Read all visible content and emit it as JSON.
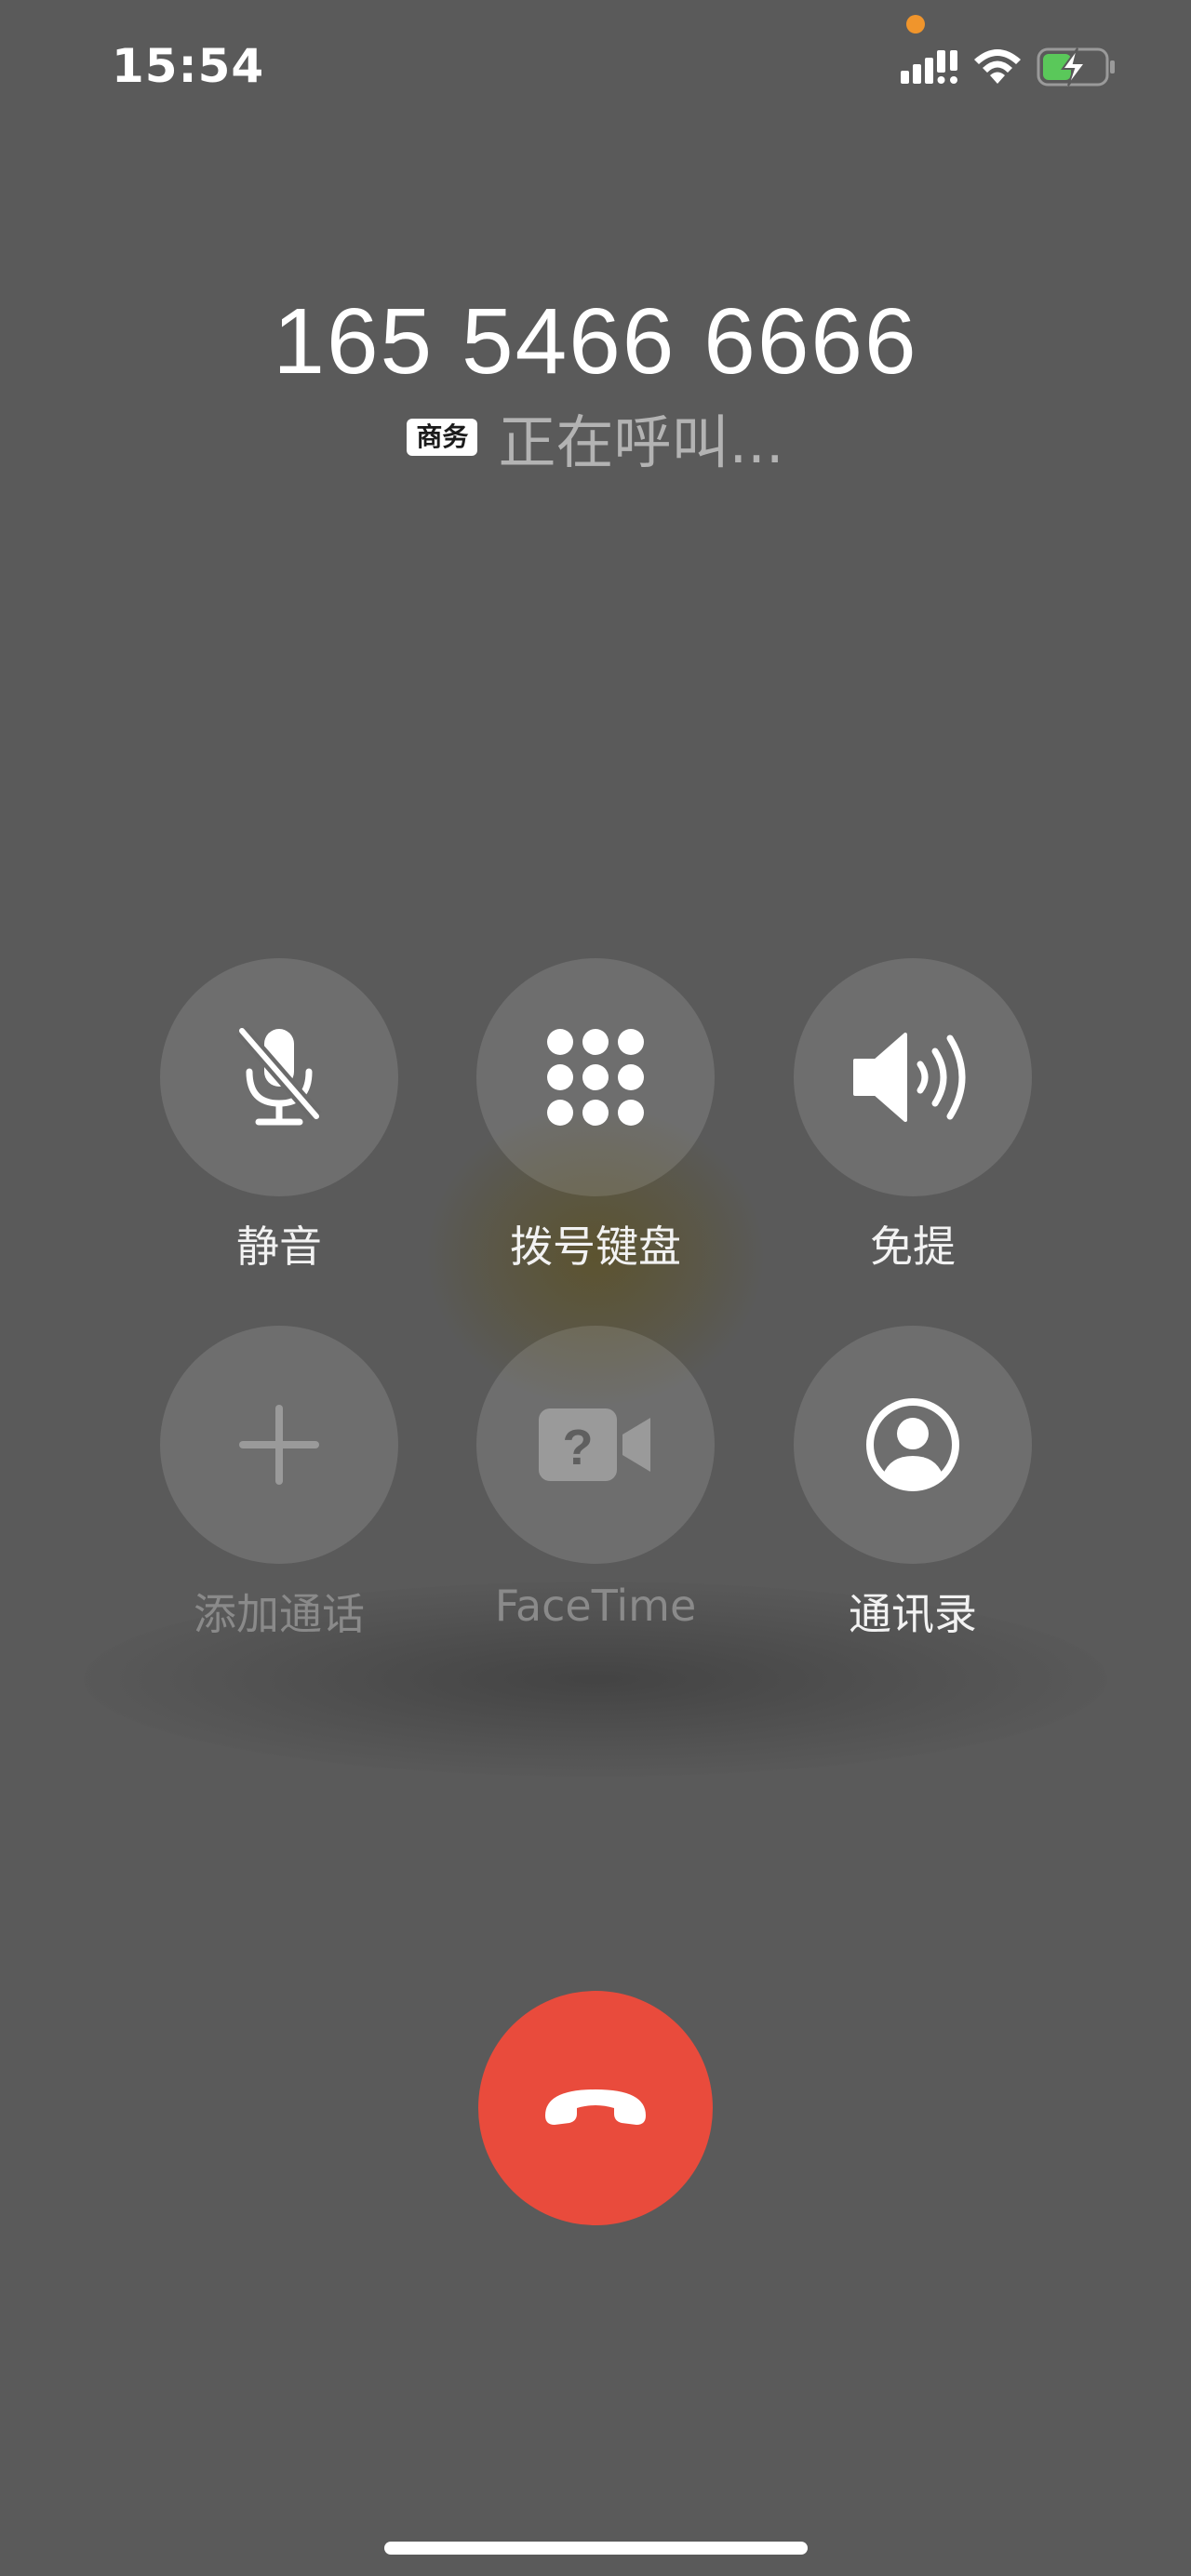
{
  "status_bar": {
    "time": "15:54"
  },
  "caller": {
    "number": "165 5466 6666",
    "line_badge": "商务",
    "status": "正在呼叫..."
  },
  "controls": {
    "mute": "静音",
    "keypad": "拨号键盘",
    "speaker": "免提",
    "add_call": "添加通话",
    "facetime": "FaceTime",
    "contacts": "通讯录"
  },
  "colors": {
    "background": "#5a5a5a",
    "end_call": "#e94b3c",
    "privacy_dot": "#f0952c",
    "battery_fill": "#5ac85a"
  },
  "icons": {
    "mute": "mic-slash-icon",
    "keypad": "keypad-icon",
    "speaker": "speaker-wave-icon",
    "add_call": "plus-icon",
    "facetime": "video-question-icon",
    "contacts": "person-circle-icon",
    "end_call": "phone-down-icon"
  }
}
